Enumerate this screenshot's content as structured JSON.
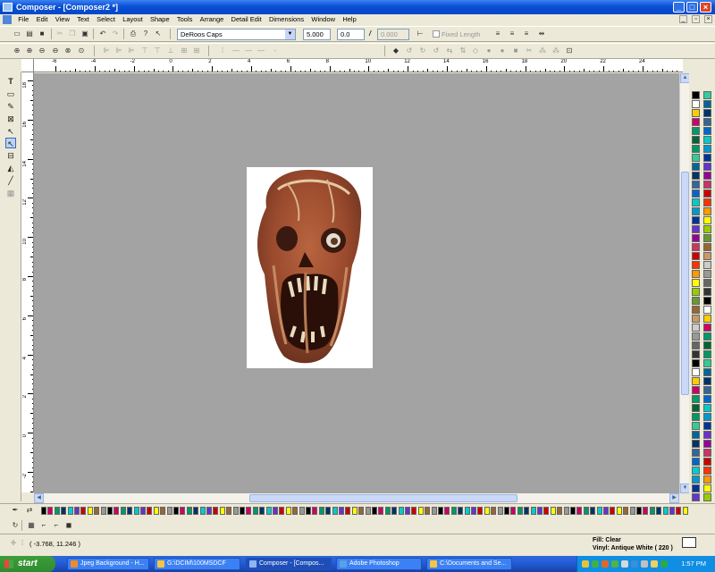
{
  "window": {
    "title": "Composer - [Composer2 *]",
    "buttons": {
      "minimize": "_",
      "maximize": "□",
      "close": "×"
    }
  },
  "menu": [
    "File",
    "Edit",
    "View",
    "Text",
    "Select",
    "Layout",
    "Shape",
    "Tools",
    "Arrange",
    "Detail Edit",
    "Dimensions",
    "Window",
    "Help"
  ],
  "toolbar": {
    "font_name": "DeRoos Caps",
    "font_size": "5.000",
    "char_spacing": "0.0",
    "italic_angle": "0.000",
    "fixed_length_label": "Fixed Length"
  },
  "ruler_h": [
    "-6",
    "-4",
    "-2",
    "0",
    "2",
    "4",
    "6",
    "8",
    "10",
    "12",
    "14",
    "16",
    "18",
    "20",
    "22",
    "24"
  ],
  "ruler_v": [
    "18",
    "16",
    "14",
    "12",
    "10",
    "8",
    "6",
    "4",
    "2",
    "0",
    "-2"
  ],
  "status": {
    "coords": "( -3.768, 11.246 )",
    "fill": "Fill: Clear",
    "vinyl": "Vinyl: Antique White ( 220 )"
  },
  "taskbar": {
    "start_label": "start",
    "tasks": [
      "Jpeg Background - H...",
      "G:\\DCIM\\100MSDCF",
      "Composer - [Compos...",
      "Adobe Photoshop",
      "C:\\Documents and Se..."
    ],
    "time": "1:57 PM"
  },
  "colors": {
    "title_bar": "#0a4fd4",
    "canvas": "#a3a3a3",
    "document": "#ffffff",
    "taskbar": "#245edb",
    "start_button": "#3c9e3c",
    "palette": [
      "#000000",
      "#ffffff",
      "#ffcc00",
      "#cc0066",
      "#00996a",
      "#006633",
      "#009966",
      "#33cc99",
      "#006699",
      "#003366",
      "#336699",
      "#0066cc",
      "#00cccc",
      "#0099cc",
      "#003399",
      "#6633cc",
      "#990099",
      "#cc3366",
      "#cc0000",
      "#ff3300",
      "#ff9900",
      "#ffff00",
      "#99cc00",
      "#669933",
      "#996633",
      "#cc9966",
      "#cccccc",
      "#999999",
      "#666666",
      "#333333"
    ]
  }
}
